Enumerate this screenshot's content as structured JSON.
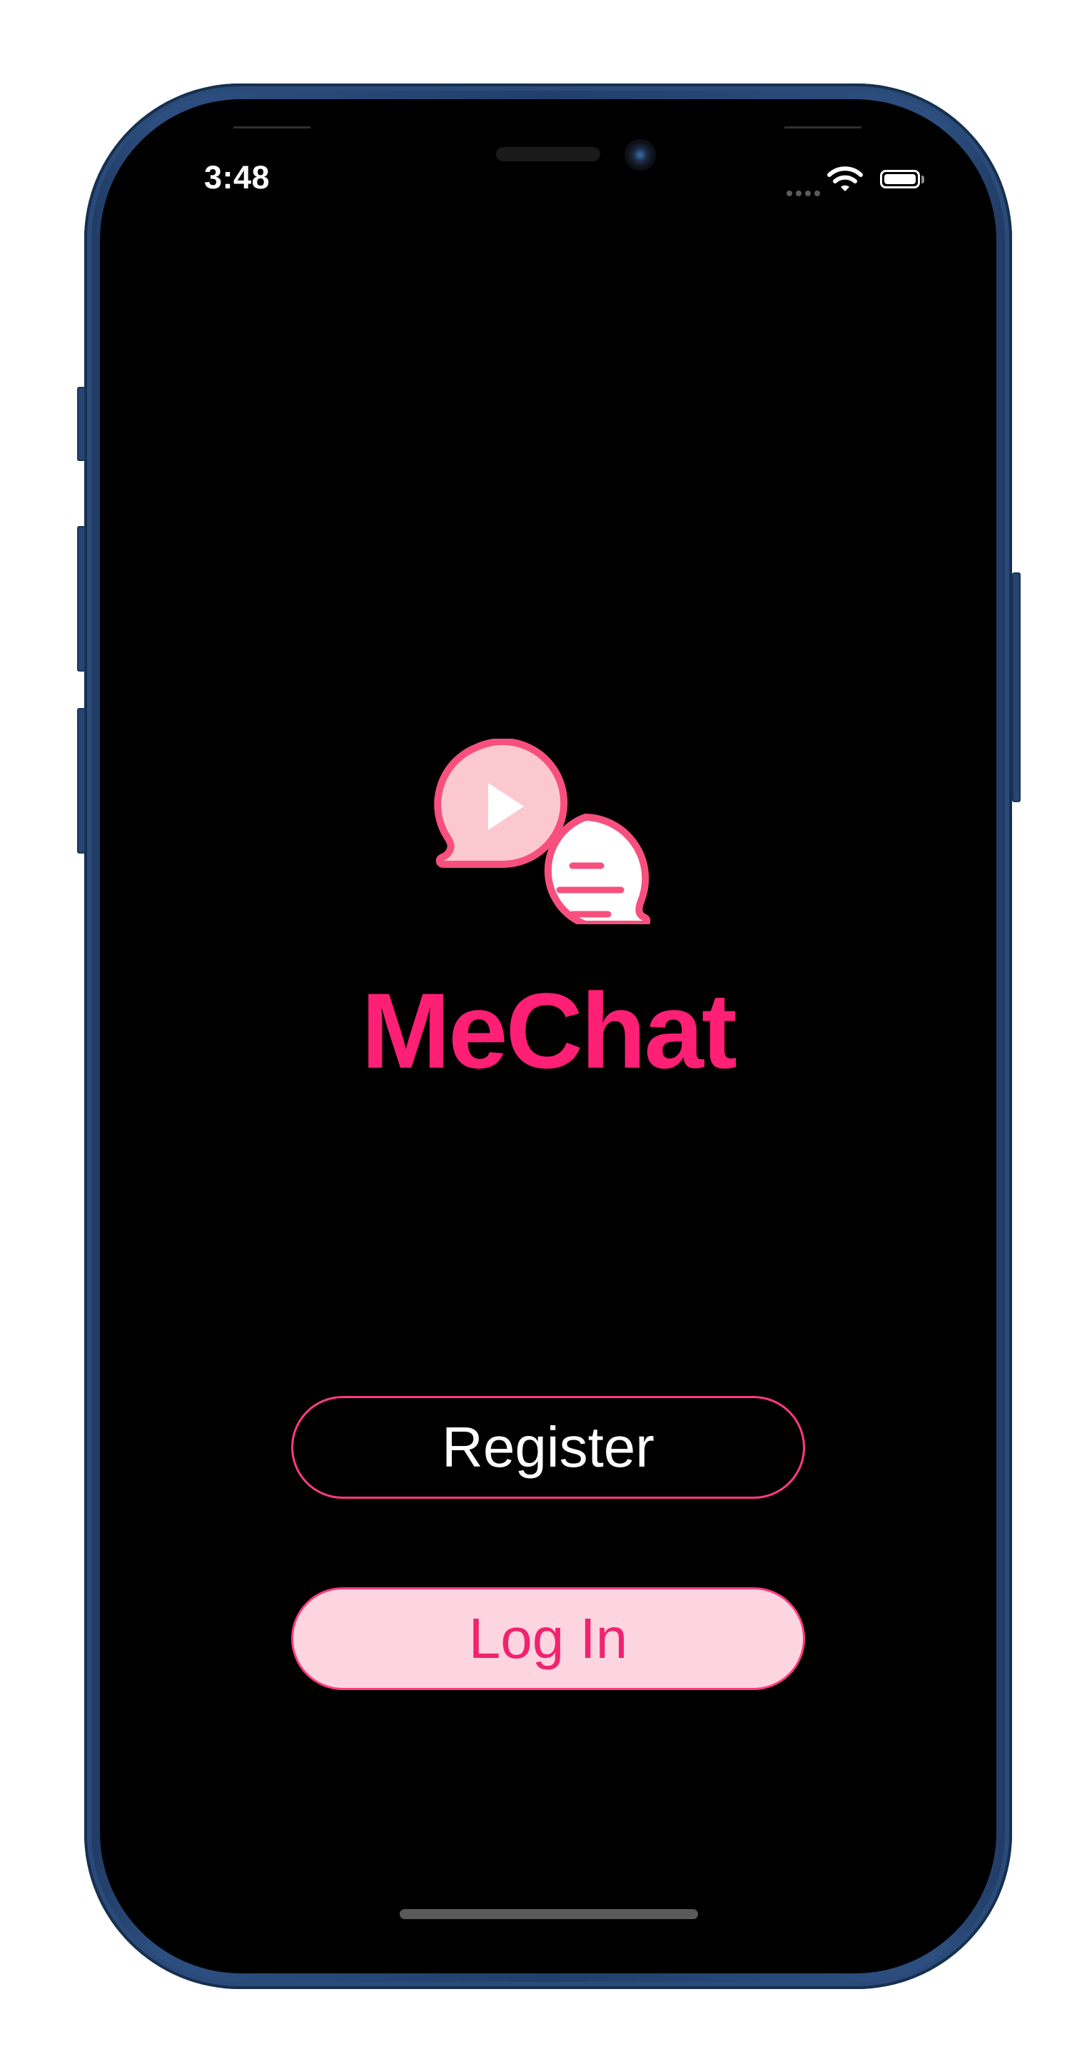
{
  "status_bar": {
    "time": "3:48",
    "icons": [
      "cellular-signal-icon",
      "wifi-icon",
      "battery-icon"
    ]
  },
  "app": {
    "title": "MeChat",
    "logo_icon": "chat-bubbles-logo-icon"
  },
  "actions": {
    "register_label": "Register",
    "login_label": "Log In"
  },
  "colors": {
    "brand": "#ff1f75",
    "logo_fill_light": "#ffffff",
    "logo_fill_pink": "#fcc8cf",
    "logo_stroke": "#f7507e",
    "login_background": "#fcd5e0",
    "background": "#000000"
  }
}
